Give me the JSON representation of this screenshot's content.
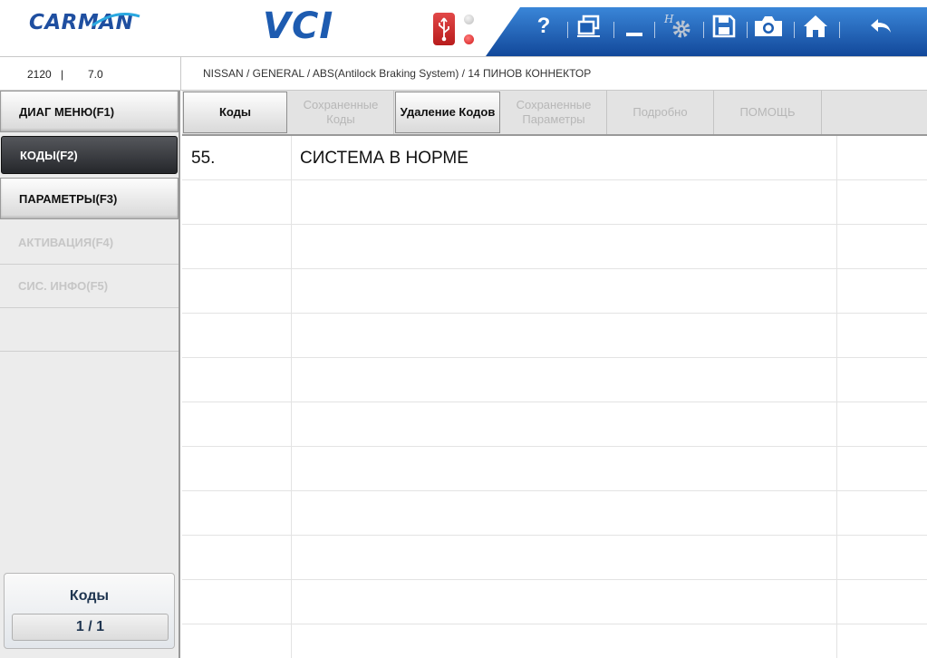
{
  "header": {
    "logo_text": "CARMAN",
    "app_title": "VCI",
    "brand_color": "#1d5bb0",
    "toolbar_color": "#1d5db5",
    "toolbar_icons": [
      "help-icon",
      "window-restore-icon",
      "minimize-icon",
      "settings-icon",
      "save-icon",
      "camera-icon",
      "home-icon",
      "back-icon"
    ],
    "help_label": "?"
  },
  "infobar": {
    "version_a": "2120",
    "separator": "|",
    "version_b": "7.0",
    "breadcrumb": "NISSAN / GENERAL / ABS(Antilock Braking System) / 14 ПИНОВ КОННЕКТОР"
  },
  "sidebar": {
    "items": [
      {
        "label": "ДИАГ МЕНЮ(F1)",
        "state": "enabled"
      },
      {
        "label": "КОДЫ(F2)",
        "state": "selected"
      },
      {
        "label": "ПАРАМЕТРЫ(F3)",
        "state": "enabled"
      },
      {
        "label": "АКТИВАЦИЯ(F4)",
        "state": "disabled"
      },
      {
        "label": "СИС. ИНФО(F5)",
        "state": "disabled"
      }
    ],
    "page_title": "Коды",
    "page_indicator": "1 / 1"
  },
  "tabs": [
    {
      "label": "Коды",
      "state": "enabled"
    },
    {
      "label": "Сохраненные Коды",
      "state": "disabled"
    },
    {
      "label": "Удаление Кодов",
      "state": "enabled"
    },
    {
      "label": "Сохраненные Параметры",
      "state": "disabled"
    },
    {
      "label": "Подробно",
      "state": "disabled"
    },
    {
      "label": "ПОМОЩЬ",
      "state": "disabled"
    }
  ],
  "codes_table": {
    "rows": [
      {
        "code": "55.",
        "description": "СИСТЕМА В НОРМЕ"
      }
    ]
  }
}
